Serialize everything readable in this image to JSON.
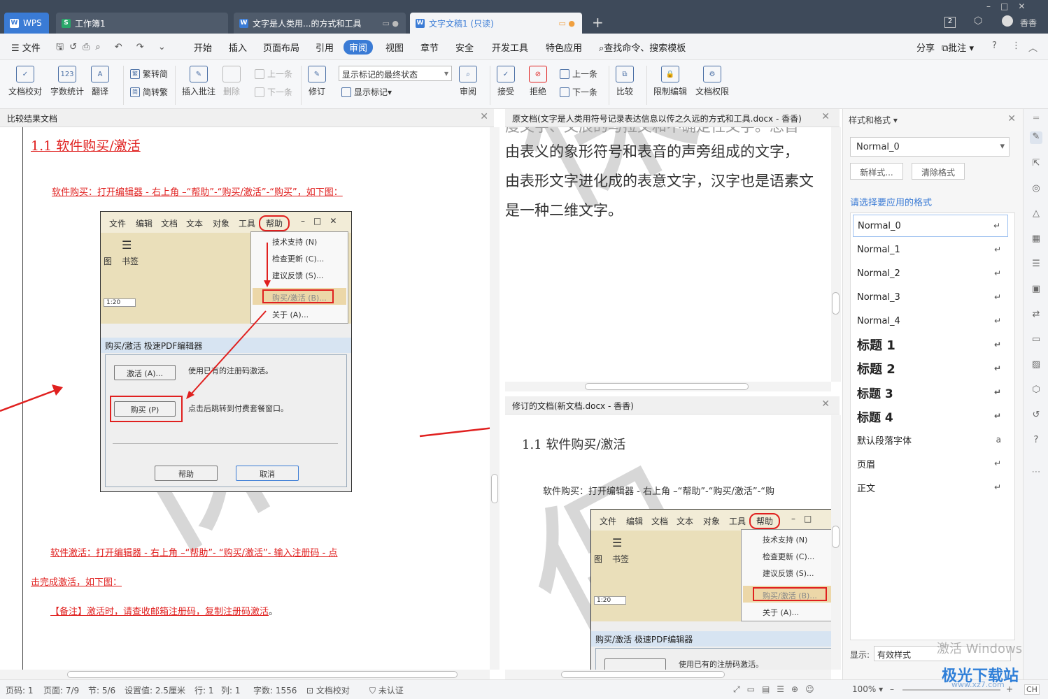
{
  "titlebar": {
    "tabs": [
      {
        "label": "WPS"
      },
      {
        "label": "工作簿1"
      },
      {
        "label": "文字是人类用...的方式和工具"
      },
      {
        "label": "文字文稿1 (只读)"
      }
    ],
    "add_tab": "+",
    "page_count": "2",
    "user": "香香"
  },
  "menubar": {
    "file": "文件",
    "items": [
      "开始",
      "插入",
      "页面布局",
      "引用",
      "审阅",
      "视图",
      "章节",
      "安全",
      "开发工具",
      "特色应用"
    ],
    "search": "查找命令、搜索模板",
    "share": "分享",
    "comment": "批注",
    "help": "?"
  },
  "ribbon": {
    "proof": "文档校对",
    "wordcount": "字数统计",
    "translate": "翻译",
    "trad": "繁转简",
    "simp": "简转繁",
    "insert_comment": "插入批注",
    "delete": "删除",
    "prev_comment": "上一条",
    "next_comment": "下一条",
    "revise": "修订",
    "markup_select": "显示标记的最终状态",
    "show_markup": "显示标记",
    "review": "审阅",
    "accept": "接受",
    "reject": "拒绝",
    "prev": "上一条",
    "next": "下一条",
    "compare": "比较",
    "restrict": "限制编辑",
    "permission": "文档权限"
  },
  "left_pane": {
    "title": "比较结果文档",
    "heading": "1.1 软件购买/激活",
    "line1": "软件购买：打开编辑器 - 右上角 –“帮助”-“购买/激活”-“购买”，如下图：",
    "line2a": "软件激活：打开编辑器 - 右上角 –“帮助”- “购买/激活”- 输入注册码 - 点",
    "line2b": "击完成激活，如下图：",
    "note": "【备注】激活时，请查收邮箱注册码，复制注册码激活",
    "note_end": "。"
  },
  "embedded_shot": {
    "menus": [
      "文件",
      "编辑",
      "文档",
      "文本",
      "对象",
      "工具",
      "帮助"
    ],
    "bookmark": "书签",
    "side_char": "图",
    "zoom_box": "1:20",
    "help_items": [
      "技术支持 (N)",
      "检查更新 (C)...",
      "建议反馈 (S)...",
      "购买/激活 (B)...",
      "关于 (A)..."
    ],
    "dialog_title": "购买/激活 极速PDF编辑器",
    "activate_btn": "激活 (A)...",
    "activate_text": "使用已有的注册码激活。",
    "buy_btn": "购买 (P)",
    "buy_text": "点击后跳转到付费套餐窗口。",
    "help_btn": "帮助",
    "cancel_btn": "取消"
  },
  "orig_pane": {
    "title": "原文档(文字是人类用符号记录表达信息以传之久远的方式和工具.docx - 香香)",
    "lines": [
      "度文字、文辰的与拉文和不确定性文字。总首",
      "由表义的象形符号和表音的声旁组成的文字，",
      "由表形文字进化成的表意文字，汉字也是语素文",
      "是一种二维文字。"
    ]
  },
  "rev_pane": {
    "title": "修订的文档(新文档.docx - 香香)",
    "heading": "1.1 软件购买/激活",
    "line1": "软件购买：打开编辑器 - 右上角 –“帮助”-“购买/激活”-“购"
  },
  "styles_panel": {
    "title": "样式和格式",
    "current": "Normal_0",
    "new_style": "新样式...",
    "clear_format": "清除格式",
    "hint": "请选择要应用的格式",
    "items": [
      "Normal_0",
      "Normal_1",
      "Normal_2",
      "Normal_3",
      "Normal_4",
      "标题 1",
      "标题 2",
      "标题 3",
      "标题 4",
      "默认段落字体",
      "页眉",
      "正文"
    ],
    "show_label": "显示:",
    "show_value": "有效样式"
  },
  "watermark": {
    "activate": "激活 Windows",
    "site": "极光下载站",
    "url": "www.xz7.com"
  },
  "statusbar": {
    "page_num": "页码: 1",
    "page": "页面: 7/9",
    "section": "节: 5/6",
    "setting": "设置值: 2.5厘米",
    "row": "行: 1",
    "col": "列: 1",
    "words": "字数: 1556",
    "proof": "文档校对",
    "cert": "未认证",
    "zoom": "100%",
    "ime": "CH"
  },
  "colors": {
    "accent": "#3a7bd5",
    "revision": "#e0201f",
    "titlebar": "#3e4a5a"
  }
}
